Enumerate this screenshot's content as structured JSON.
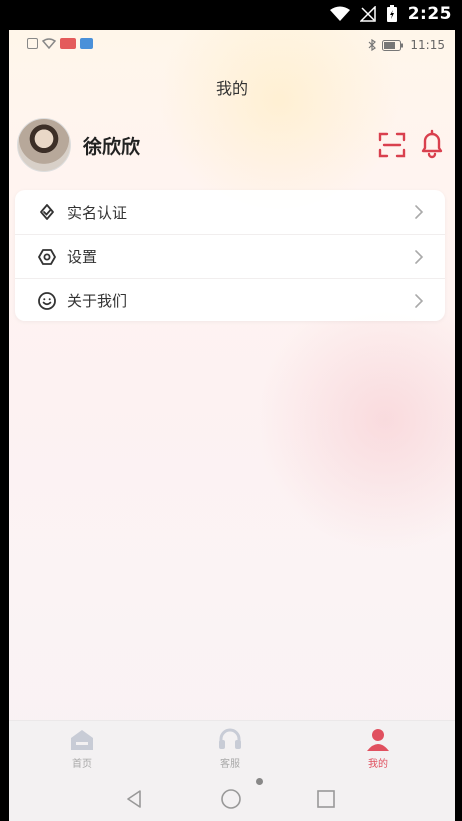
{
  "device_status": {
    "time": "2:25"
  },
  "inner_status": {
    "time": "11:15"
  },
  "page": {
    "title": "我的"
  },
  "profile": {
    "username": "徐欣欣"
  },
  "menu": [
    {
      "label": "实名认证",
      "icon": "verify-icon"
    },
    {
      "label": "设置",
      "icon": "settings-icon"
    },
    {
      "label": "关于我们",
      "icon": "smile-icon"
    }
  ],
  "tabs": [
    {
      "label": "首页",
      "icon": "home-icon",
      "active": false
    },
    {
      "label": "客服",
      "icon": "headset-icon",
      "active": false
    },
    {
      "label": "我的",
      "icon": "user-icon",
      "active": true
    }
  ],
  "colors": {
    "accent": "#e0505f",
    "inactive": "#a9a9a9",
    "text": "#333333"
  }
}
